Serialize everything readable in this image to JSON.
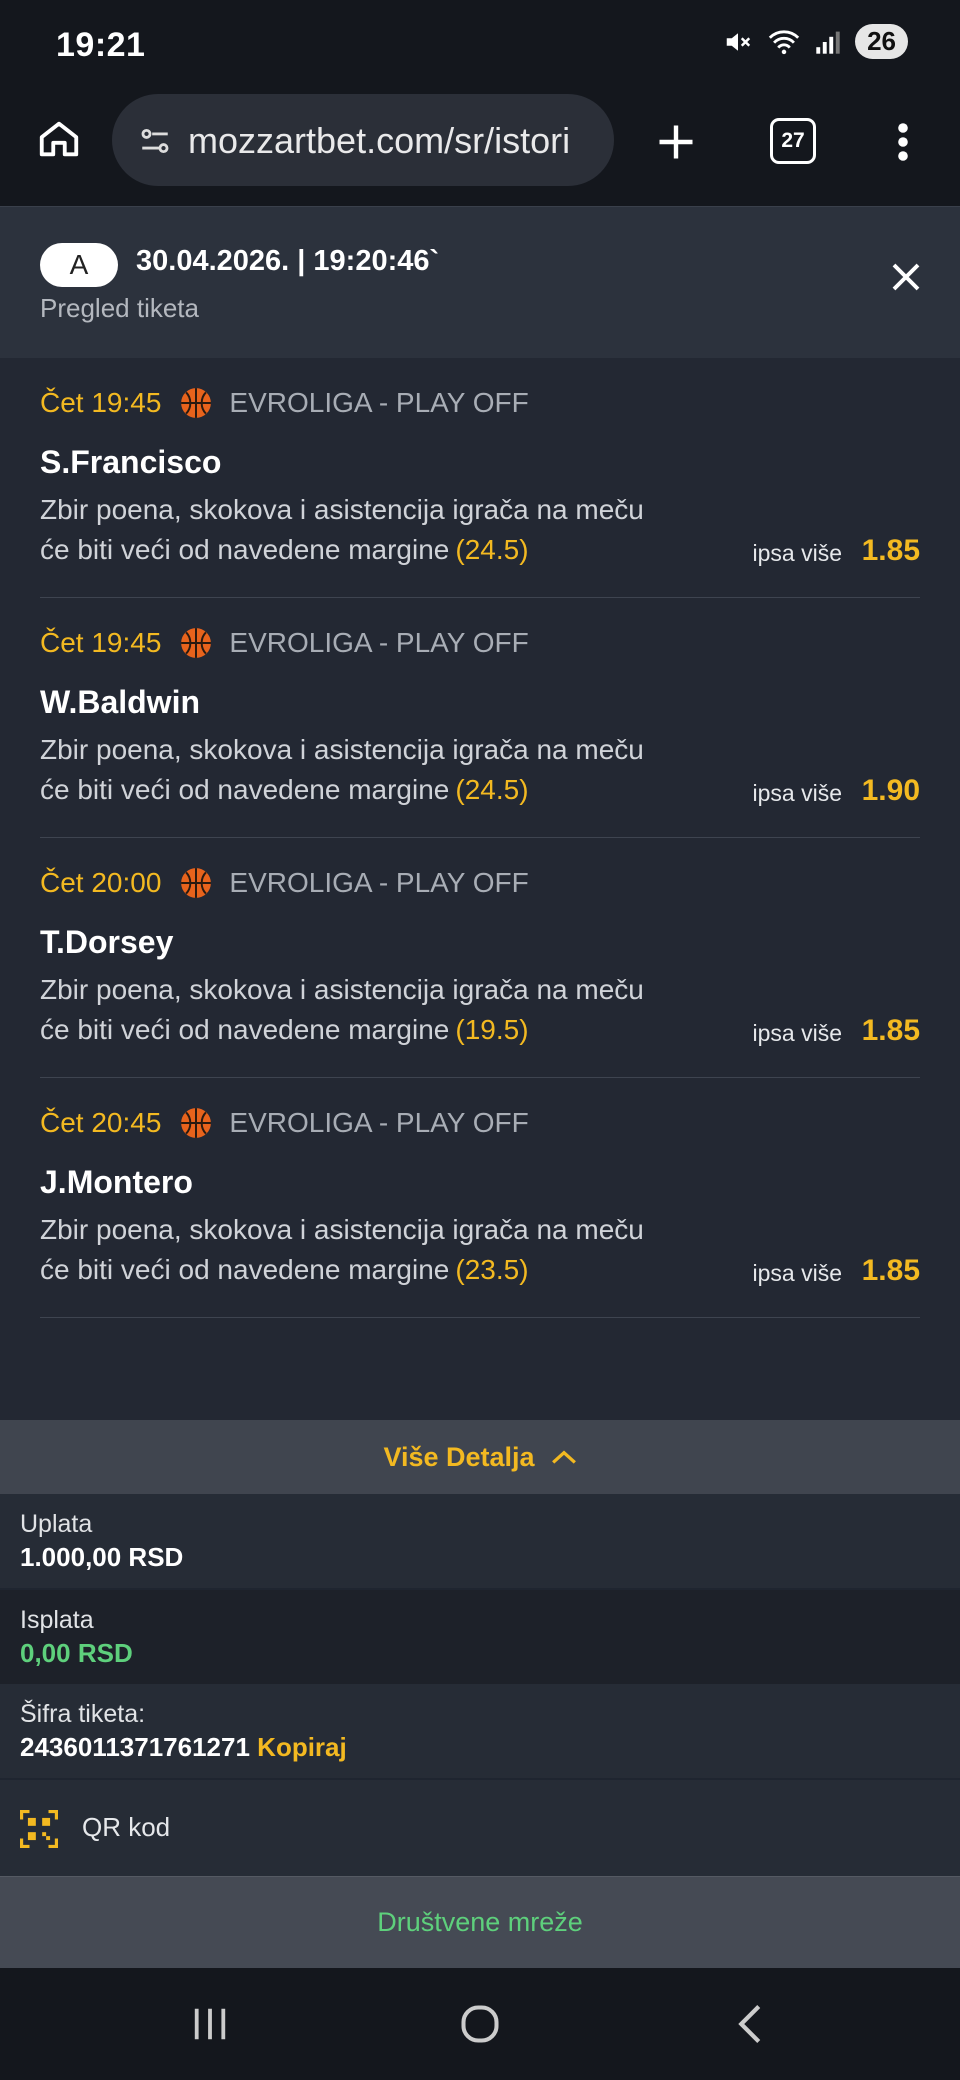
{
  "status": {
    "time": "19:21",
    "battery": "26"
  },
  "browser": {
    "url": "mozzartbet.com/sr/istori",
    "tabs_count": "27"
  },
  "ticket": {
    "badge": "A",
    "datetime": "30.04.2026. | 19:20:46`",
    "subtitle": "Pregled tiketa"
  },
  "bets": [
    {
      "time": "Čet 19:45",
      "league": "EVROLIGA - PLAY OFF",
      "player": "S.Francisco",
      "line1": "Zbir poena, skokova i asistencija igrača na meču",
      "line2": "će biti veći od navedene margine",
      "margin": "(24.5)",
      "pick": "ipsa više",
      "odd": "1.85"
    },
    {
      "time": "Čet 19:45",
      "league": "EVROLIGA - PLAY OFF",
      "player": "W.Baldwin",
      "line1": "Zbir poena, skokova i asistencija igrača na meču",
      "line2": "će biti veći od navedene margine",
      "margin": "(24.5)",
      "pick": "ipsa više",
      "odd": "1.90"
    },
    {
      "time": "Čet 20:00",
      "league": "EVROLIGA - PLAY OFF",
      "player": "T.Dorsey",
      "line1": "Zbir poena, skokova i asistencija igrača na meču",
      "line2": "će biti veći od navedene margine",
      "margin": "(19.5)",
      "pick": "ipsa više",
      "odd": "1.85"
    },
    {
      "time": "Čet 20:45",
      "league": "EVROLIGA - PLAY OFF",
      "player": "J.Montero",
      "line1": "Zbir poena, skokova i asistencija igrača na meču",
      "line2": "će biti veći od navedene margine",
      "margin": "(23.5)",
      "pick": "ipsa više",
      "odd": "1.85"
    }
  ],
  "details": {
    "toggle_label": "Više Detalja",
    "payment_label": "Uplata",
    "payment_value": "1.000,00 RSD",
    "payout_label": "Isplata",
    "payout_value": "0,00 RSD",
    "code_label": "Šifra tiketa:",
    "code_value": "2436011371761271",
    "copy_label": "Kopiraj",
    "qr_label": "QR kod",
    "social_label": "Društvene mreže"
  },
  "colors": {
    "accent": "#f3b921",
    "green": "#5ed07c"
  }
}
